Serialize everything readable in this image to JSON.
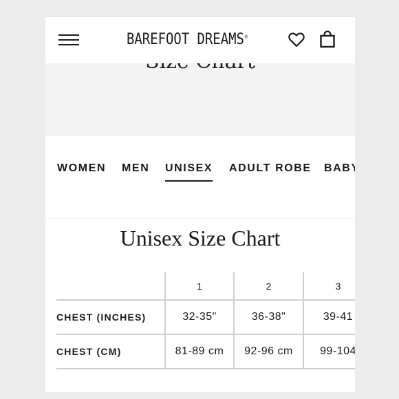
{
  "header": {
    "brand": "BAREFOOT DREAMS",
    "brand_mark": "®",
    "icons": [
      "menu-icon",
      "heart-icon",
      "bag-icon"
    ]
  },
  "banner": {
    "title": "Size Chart"
  },
  "tabs": [
    {
      "label": "WOMEN",
      "active": false
    },
    {
      "label": "MEN",
      "active": false
    },
    {
      "label": "UNISEX",
      "active": true
    },
    {
      "label": "ADULT ROBE",
      "active": false
    },
    {
      "label": "BABY",
      "active": false
    }
  ],
  "chart": {
    "title": "Unisex Size Chart",
    "columns": [
      "1",
      "2",
      "3"
    ],
    "rows": [
      {
        "label": "CHEST (INCHES)",
        "values": [
          "32-35\"",
          "36-38\"",
          "39-41"
        ]
      },
      {
        "label": "CHEST (CM)",
        "values": [
          "81-89 cm",
          "92-96 cm",
          "99-104"
        ]
      }
    ]
  },
  "colors": {
    "text": "#1a1a1a",
    "banner_bg": "#f3f3f3",
    "border": "#cfcfcf",
    "outer_bg": "#ececec"
  }
}
